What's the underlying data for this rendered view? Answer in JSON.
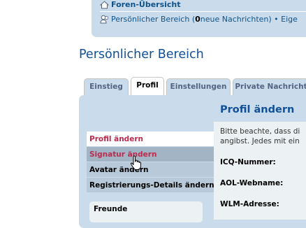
{
  "navbar": {
    "home_link": "Foren-Übersicht",
    "user_area_prefix": "Persönlicher Bereich (",
    "new_messages_count": "0",
    "user_area_suffix": " neue Nachrichten) • Eige"
  },
  "page": {
    "title": "Persönlicher Bereich"
  },
  "tabs": [
    {
      "label": "Einstieg",
      "active": false
    },
    {
      "label": "Profil",
      "active": true
    },
    {
      "label": "Einstellungen",
      "active": false
    },
    {
      "label": "Private Nachricht",
      "active": false
    }
  ],
  "menu": {
    "items": [
      {
        "label": "Profil ändern",
        "state": "current"
      },
      {
        "label": "Signatur ändern",
        "state": "hover"
      },
      {
        "label": "Avatar ändern",
        "state": "normal"
      },
      {
        "label": "Registrierungs-Details ändern",
        "state": "normal"
      }
    ]
  },
  "friends": {
    "title": "Freunde"
  },
  "main": {
    "title": "Profil ändern",
    "intro_line1": "Bitte beachte, dass di",
    "intro_line2": "angibst. Jedes mit ein",
    "fields": [
      {
        "label": "ICQ-Nummer:"
      },
      {
        "label": "AOL-Webname:"
      },
      {
        "label": "WLM-Adresse:"
      }
    ]
  },
  "colors": {
    "nav_bg": "#cadceb",
    "link": "#105289",
    "title": "#115098",
    "menu_active": "#bc2a4d",
    "content_bg": "#ecf1f3"
  }
}
